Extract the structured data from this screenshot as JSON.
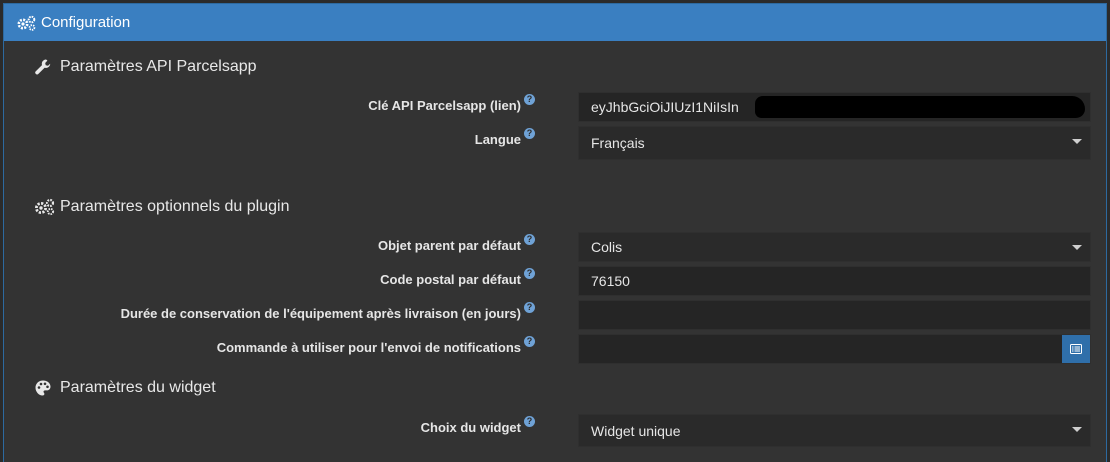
{
  "header": {
    "title": "Configuration",
    "icon": "gears-icon"
  },
  "sections": [
    {
      "title": "Paramètres API Parcelsapp",
      "icon": "wrench-icon",
      "fields": [
        {
          "label": "Clé API Parcelsapp",
          "label_link": "(lien)",
          "value": "eyJhbGciOiJIUzI1NiIsIn",
          "type": "text"
        },
        {
          "label": "Langue",
          "value": "Français",
          "type": "select"
        }
      ]
    },
    {
      "title": "Paramètres optionnels du plugin",
      "icon": "gears-icon",
      "fields": [
        {
          "label": "Objet parent par défaut",
          "value": "Colis",
          "type": "select"
        },
        {
          "label": "Code postal par défaut",
          "value": "76150",
          "type": "text"
        },
        {
          "label": "Durée de conservation de l'équipement après livraison (en jours)",
          "value": "",
          "type": "text"
        },
        {
          "label": "Commande à utiliser pour l'envoi de notifications",
          "value": "",
          "type": "text-with-button",
          "button_icon": "list-alt-icon"
        }
      ]
    },
    {
      "title": "Paramètres du widget",
      "icon": "palette-icon",
      "fields": [
        {
          "label": "Choix du widget",
          "value": "Widget unique",
          "type": "select"
        }
      ]
    }
  ],
  "help_glyph": "?"
}
